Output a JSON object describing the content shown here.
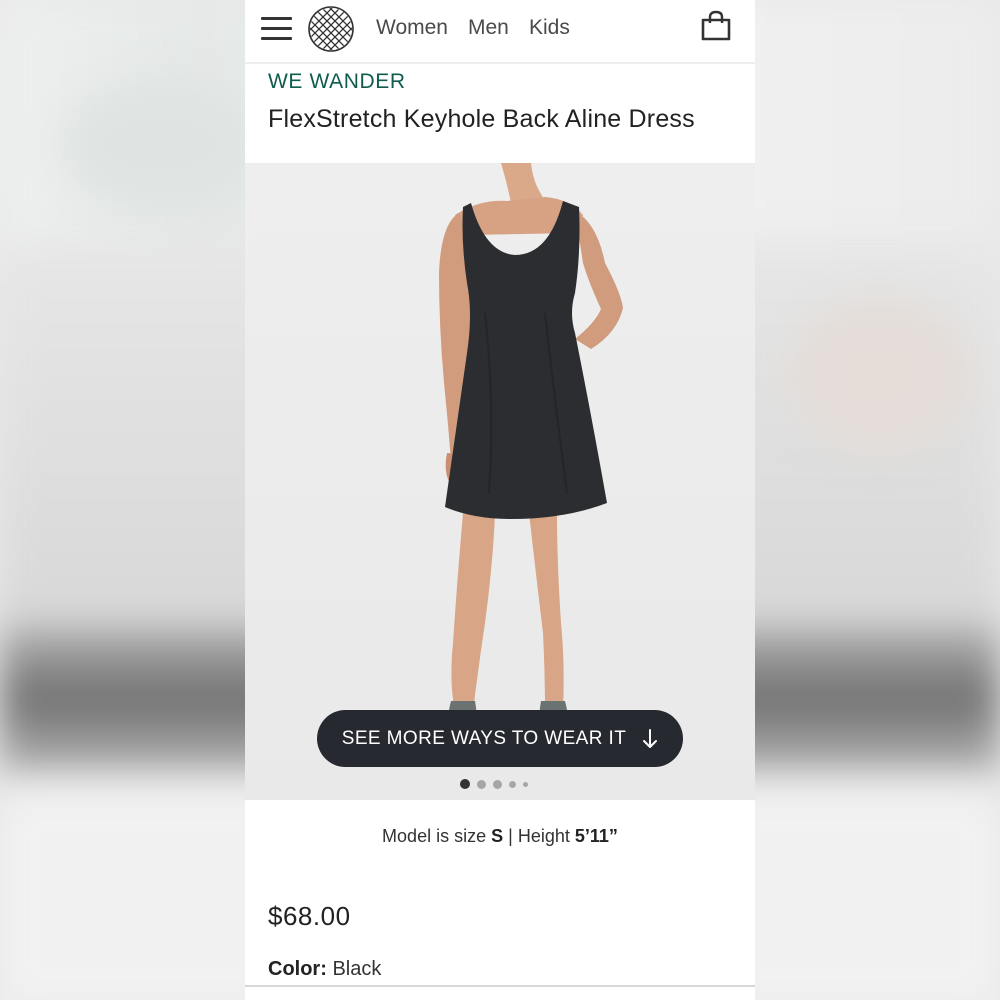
{
  "nav": {
    "links": [
      "Women",
      "Men",
      "Kids"
    ]
  },
  "product": {
    "brand": "WE WANDER",
    "title": "FlexStretch Keyhole Back Aline Dress",
    "see_more_label": "SEE MORE WAYS TO WEAR IT",
    "carousel": {
      "total": 5,
      "active": 1
    },
    "model_info": {
      "prefix": "Model is size",
      "size": "S",
      "separator": "|",
      "height_label": "Height",
      "height": "5’11”"
    },
    "price": "$68.00",
    "color_label": "Color:",
    "color_value": "Black"
  },
  "colors": {
    "brand_green": "#0f5c4f",
    "button_dark": "#262a30",
    "text": "#222222"
  },
  "icons": [
    "hamburger-menu-icon",
    "stitch-fix-logo",
    "shopping-bag-icon",
    "arrow-down-icon"
  ]
}
